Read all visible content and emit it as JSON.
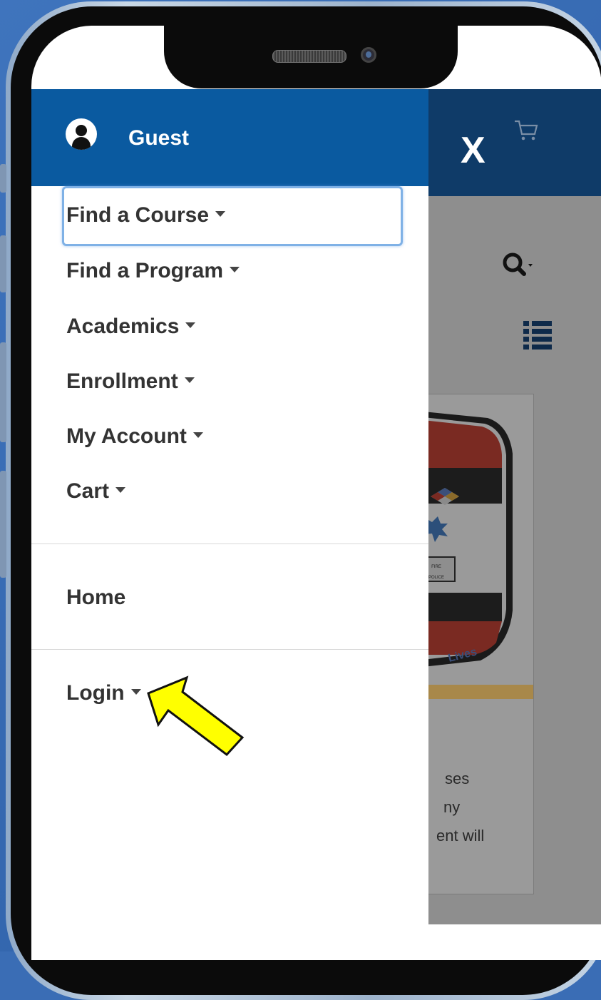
{
  "header": {
    "user_name": "Guest",
    "close_label": "X"
  },
  "menu": {
    "items": [
      {
        "label": "Find a Course"
      },
      {
        "label": "Find a Program"
      },
      {
        "label": "Academics"
      },
      {
        "label": "Enrollment"
      },
      {
        "label": "My Account"
      },
      {
        "label": "Cart"
      }
    ],
    "home_label": "Home",
    "login_label": "Login"
  },
  "background_page": {
    "text_lines": [
      "ses",
      "ny",
      "ent will"
    ]
  },
  "icons": {
    "avatar": "user-avatar-icon",
    "cart": "cart-icon",
    "search": "search-icon",
    "list": "list-view-icon",
    "annotation": "pointer-arrow-icon"
  },
  "colors": {
    "drawer_header": "#0a5aa0",
    "page_header": "#0f3b68",
    "focus_outline": "#7fb1e6",
    "arrow_fill": "#ffff00",
    "background": "#3a6db5"
  }
}
